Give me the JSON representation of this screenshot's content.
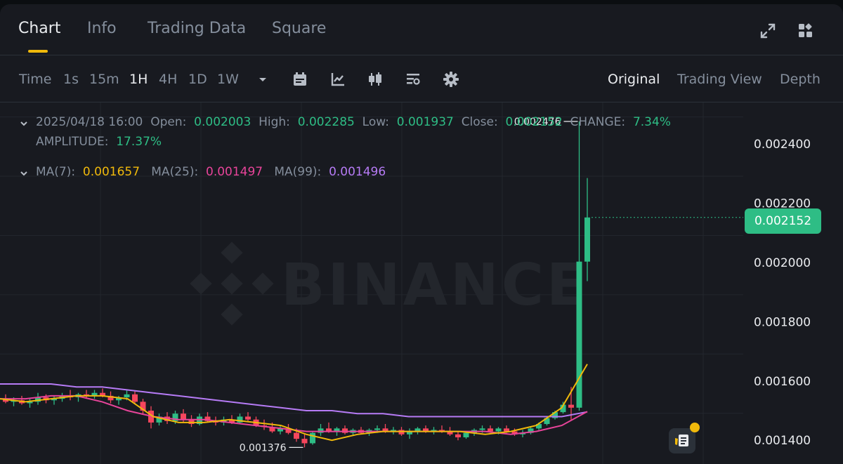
{
  "tabs": {
    "chart": "Chart",
    "info": "Info",
    "trading_data": "Trading Data",
    "square": "Square"
  },
  "toolbar": {
    "time": "Time",
    "intervals": [
      "1s",
      "15m",
      "1H",
      "4H",
      "1D",
      "1W"
    ],
    "active_interval": "1H",
    "views": {
      "original": "Original",
      "trading_view": "Trading View",
      "depth": "Depth"
    }
  },
  "ohlc": {
    "datetime": "2025/04/18 16:00",
    "open_label": "Open:",
    "open": "0.002003",
    "high_label": "High:",
    "high": "0.002285",
    "low_label": "Low:",
    "low": "0.001937",
    "close_label": "Close:",
    "close": "0.002152",
    "change_label": "CHANGE:",
    "change": "7.34%",
    "amplitude_label": "AMPLITUDE:",
    "amplitude": "17.37%"
  },
  "ma": {
    "ma7_label": "MA(7):",
    "ma7": "0.001657",
    "ma25_label": "MA(25):",
    "ma25": "0.001497",
    "ma99_label": "MA(99):",
    "ma99": "0.001496"
  },
  "watermark": "BINANCE",
  "current_price": "0.002152",
  "colors": {
    "up": "#2ebd85",
    "down": "#f6465d",
    "ma7": "#f0b90b",
    "ma25": "#e8449a",
    "ma99": "#b67bf5",
    "accent": "#f0b90b"
  },
  "icons": [
    "expand-icon",
    "widgets-icon",
    "calendar-icon",
    "indicator-icon",
    "candlestick-icon",
    "settings-list-icon",
    "gear-icon",
    "notes-icon"
  ],
  "chart_data": {
    "type": "candlestick",
    "interval": "1H",
    "ylim": [
      0.00132,
      0.00254
    ],
    "y_ticks": [
      "0.002400",
      "0.002200",
      "0.002000",
      "0.001800",
      "0.001600",
      "0.001400"
    ],
    "y_tick_values": [
      0.0024,
      0.0022,
      0.002,
      0.0018,
      0.0016,
      0.0014
    ],
    "grid": true,
    "max_label": "0.002476",
    "max_value": 0.002476,
    "min_label": "0.001376",
    "min_value": 0.001376,
    "candles": [
      [
        0.00154,
        0.001555,
        0.001525,
        0.00153
      ],
      [
        0.00153,
        0.001545,
        0.001515,
        0.001535
      ],
      [
        0.001535,
        0.00155,
        0.00152,
        0.001525
      ],
      [
        0.001525,
        0.00154,
        0.00151,
        0.00153
      ],
      [
        0.00153,
        0.00156,
        0.00152,
        0.001545
      ],
      [
        0.001545,
        0.001555,
        0.001525,
        0.001535
      ],
      [
        0.001535,
        0.00155,
        0.00152,
        0.00154
      ],
      [
        0.00154,
        0.00156,
        0.00153,
        0.00155
      ],
      [
        0.00155,
        0.00157,
        0.001535,
        0.001545
      ],
      [
        0.001545,
        0.00156,
        0.00153,
        0.001555
      ],
      [
        0.001555,
        0.00157,
        0.00154,
        0.00155
      ],
      [
        0.00155,
        0.00157,
        0.00154,
        0.00156
      ],
      [
        0.00156,
        0.001575,
        0.001545,
        0.00155
      ],
      [
        0.00155,
        0.001565,
        0.001525,
        0.001535
      ],
      [
        0.001535,
        0.00155,
        0.00152,
        0.001545
      ],
      [
        0.001545,
        0.00157,
        0.001535,
        0.001555
      ],
      [
        0.001555,
        0.001565,
        0.001525,
        0.00153
      ],
      [
        0.00153,
        0.00154,
        0.00149,
        0.0015
      ],
      [
        0.0015,
        0.001515,
        0.00144,
        0.00146
      ],
      [
        0.00146,
        0.00149,
        0.00145,
        0.00148
      ],
      [
        0.00148,
        0.001495,
        0.001455,
        0.001465
      ],
      [
        0.001465,
        0.0015,
        0.001455,
        0.00149
      ],
      [
        0.00149,
        0.001505,
        0.00146,
        0.00147
      ],
      [
        0.00147,
        0.001485,
        0.001445,
        0.001455
      ],
      [
        0.001455,
        0.00149,
        0.00145,
        0.00148
      ],
      [
        0.00148,
        0.001495,
        0.00146,
        0.001465
      ],
      [
        0.001465,
        0.00148,
        0.00145,
        0.00146
      ],
      [
        0.00146,
        0.00148,
        0.00145,
        0.00147
      ],
      [
        0.00147,
        0.001485,
        0.001455,
        0.00146
      ],
      [
        0.00146,
        0.00149,
        0.001455,
        0.00148
      ],
      [
        0.00148,
        0.001495,
        0.001465,
        0.00147
      ],
      [
        0.00147,
        0.00148,
        0.001445,
        0.00145
      ],
      [
        0.00145,
        0.00147,
        0.001435,
        0.001445
      ],
      [
        0.001445,
        0.00146,
        0.001425,
        0.00143
      ],
      [
        0.00143,
        0.00145,
        0.00142,
        0.00144
      ],
      [
        0.00144,
        0.001455,
        0.00142,
        0.001425
      ],
      [
        0.001425,
        0.00144,
        0.001395,
        0.001405
      ],
      [
        0.001405,
        0.00142,
        0.001376,
        0.00139
      ],
      [
        0.00139,
        0.00143,
        0.001385,
        0.001425
      ],
      [
        0.001425,
        0.001455,
        0.001415,
        0.00144
      ],
      [
        0.00144,
        0.00146,
        0.001425,
        0.00143
      ],
      [
        0.00143,
        0.001445,
        0.001415,
        0.00144
      ],
      [
        0.00144,
        0.00145,
        0.00142,
        0.001425
      ],
      [
        0.001425,
        0.00144,
        0.001415,
        0.001435
      ],
      [
        0.001435,
        0.001445,
        0.00142,
        0.001425
      ],
      [
        0.001425,
        0.00144,
        0.001415,
        0.001435
      ],
      [
        0.001435,
        0.00145,
        0.001425,
        0.00144
      ],
      [
        0.00144,
        0.001455,
        0.001425,
        0.00143
      ],
      [
        0.00143,
        0.001445,
        0.00142,
        0.001435
      ],
      [
        0.001435,
        0.001445,
        0.001415,
        0.00142
      ],
      [
        0.00142,
        0.00144,
        0.001405,
        0.00143
      ],
      [
        0.00143,
        0.001445,
        0.00142,
        0.00144
      ],
      [
        0.00144,
        0.00145,
        0.001425,
        0.00143
      ],
      [
        0.00143,
        0.001445,
        0.00142,
        0.001435
      ],
      [
        0.001435,
        0.00145,
        0.001425,
        0.00143
      ],
      [
        0.00143,
        0.001445,
        0.001415,
        0.00142
      ],
      [
        0.00142,
        0.00143,
        0.0014,
        0.00141
      ],
      [
        0.00141,
        0.00143,
        0.001405,
        0.001425
      ],
      [
        0.001425,
        0.00144,
        0.001415,
        0.001435
      ],
      [
        0.001435,
        0.00145,
        0.001425,
        0.00144
      ],
      [
        0.00144,
        0.00145,
        0.001425,
        0.00143
      ],
      [
        0.00143,
        0.001445,
        0.00142,
        0.00144
      ],
      [
        0.00144,
        0.00145,
        0.001425,
        0.00143
      ],
      [
        0.00143,
        0.00144,
        0.001415,
        0.00142
      ],
      [
        0.00142,
        0.001435,
        0.00141,
        0.001425
      ],
      [
        0.001425,
        0.001445,
        0.00142,
        0.00144
      ],
      [
        0.00144,
        0.00146,
        0.001435,
        0.001455
      ],
      [
        0.001455,
        0.00148,
        0.00145,
        0.001475
      ],
      [
        0.001475,
        0.0015,
        0.00147,
        0.001495
      ],
      [
        0.001495,
        0.00153,
        0.00149,
        0.00152
      ],
      [
        0.00152,
        0.00158,
        0.00147,
        0.00151
      ],
      [
        0.00151,
        0.002476,
        0.0015,
        0.002003
      ],
      [
        0.002003,
        0.002285,
        0.001937,
        0.002152
      ]
    ],
    "ma7": [
      0.00154,
      0.00153,
      0.00154,
      0.00155,
      0.00155,
      0.00154,
      0.00148,
      0.00146,
      0.00146,
      0.00147,
      0.00146,
      0.00145,
      0.00142,
      0.0014,
      0.00142,
      0.00143,
      0.00143,
      0.00143,
      0.00143,
      0.00142,
      0.00143,
      0.00145,
      0.00151,
      0.001657
    ],
    "ma25": [
      0.00154,
      0.00154,
      0.00155,
      0.00155,
      0.00153,
      0.0015,
      0.00148,
      0.00147,
      0.00147,
      0.00146,
      0.00145,
      0.00144,
      0.00143,
      0.00143,
      0.00143,
      0.00143,
      0.00143,
      0.00143,
      0.00143,
      0.00143,
      0.00142,
      0.00143,
      0.00145,
      0.001497
    ],
    "ma99": [
      0.00159,
      0.00159,
      0.00159,
      0.00158,
      0.00158,
      0.00157,
      0.00156,
      0.00155,
      0.00154,
      0.00153,
      0.00152,
      0.00151,
      0.0015,
      0.0015,
      0.00149,
      0.00149,
      0.00148,
      0.00148,
      0.00148,
      0.00148,
      0.00148,
      0.00148,
      0.00148,
      0.001496
    ]
  }
}
